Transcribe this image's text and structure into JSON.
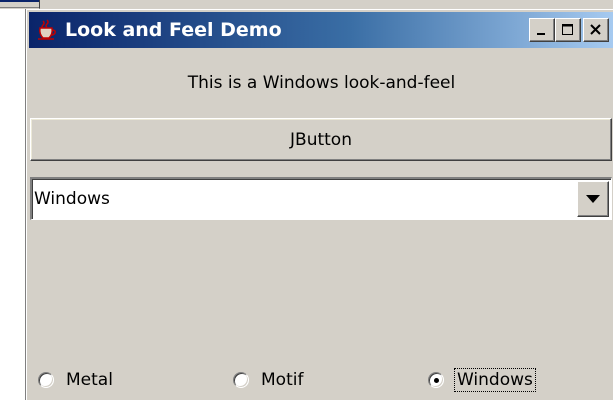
{
  "window": {
    "title": "Look and Feel Demo",
    "icon": "java-cup-icon",
    "title_buttons": [
      "minimize",
      "maximize",
      "close"
    ]
  },
  "content": {
    "info_label": "This is a Windows look-and-feel",
    "button_label": "JButton",
    "combo": {
      "selected": "Windows"
    },
    "radios": [
      {
        "label": "Metal",
        "selected": false
      },
      {
        "label": "Motif",
        "selected": false
      },
      {
        "label": "Windows",
        "selected": true
      }
    ]
  },
  "colors": {
    "face": "#d4d0c8",
    "title_active_start": "#0a246a",
    "title_active_end": "#a6caf0"
  }
}
